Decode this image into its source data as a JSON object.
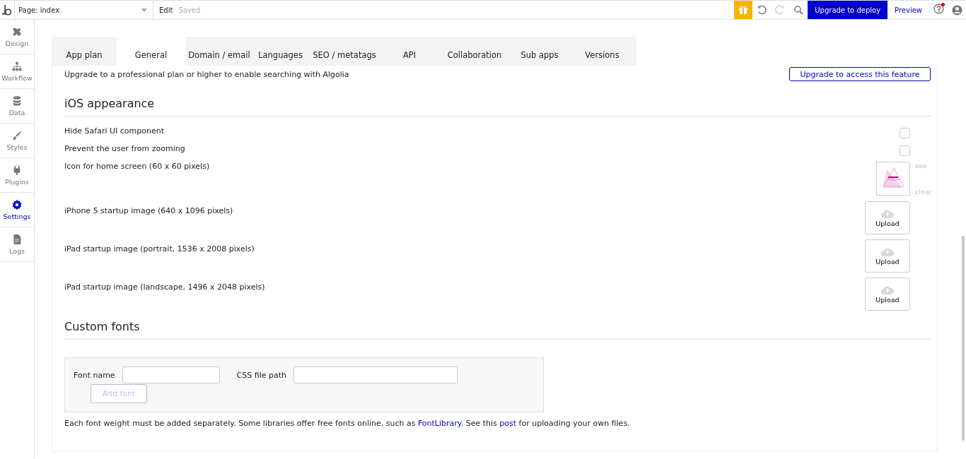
{
  "topbar": {
    "page_selector": "Page: index",
    "edit": "Edit",
    "save_status": "Saved",
    "upgrade_button": "Upgrade to deploy",
    "preview": "Preview",
    "help_notification": true
  },
  "sidebar": {
    "items": [
      {
        "label": "Design",
        "selected": false
      },
      {
        "label": "Workflow",
        "selected": false
      },
      {
        "label": "Data",
        "selected": false
      },
      {
        "label": "Styles",
        "selected": false
      },
      {
        "label": "Plugins",
        "selected": false
      },
      {
        "label": "Settings",
        "selected": true
      },
      {
        "label": "Logs",
        "selected": false
      }
    ]
  },
  "tabs": [
    {
      "label": "App plan",
      "selected": false
    },
    {
      "label": "General",
      "selected": true
    },
    {
      "label": "Domain / email",
      "selected": false
    },
    {
      "label": "Languages",
      "selected": false
    },
    {
      "label": "SEO / metatags",
      "selected": false
    },
    {
      "label": "API",
      "selected": false
    },
    {
      "label": "Collaboration",
      "selected": false
    },
    {
      "label": "Sub apps",
      "selected": false
    },
    {
      "label": "Versions",
      "selected": false
    }
  ],
  "algolia": {
    "text": "Upgrade to a professional plan or higher to enable searching with Algolia",
    "button": "Upgrade to access this feature"
  },
  "ios_appearance": {
    "title": "iOS appearance",
    "rows": [
      {
        "kind": "checkbox",
        "label": "Hide Safari UI component",
        "checked": false
      },
      {
        "kind": "checkbox",
        "label": "Prevent the user from zooming",
        "checked": false
      },
      {
        "kind": "image",
        "label": "Icon for home screen (60 x 60 pixels)",
        "see": "see",
        "clear": "clear"
      },
      {
        "kind": "upload",
        "label": "iPhone 5 startup image (640 x 1096 pixels)",
        "button": "Upload"
      },
      {
        "kind": "upload",
        "label": "iPad startup image (portrait, 1536 x 2008 pixels)",
        "button": "Upload"
      },
      {
        "kind": "upload",
        "label": "iPad startup image (landscape, 1496 x 2048 pixels)",
        "button": "Upload"
      }
    ]
  },
  "custom_fonts": {
    "title": "Custom fonts",
    "fields": [
      {
        "label": "Font name"
      },
      {
        "label": "CSS file path"
      }
    ],
    "add_button": {
      "label": "Add font",
      "disabled": true
    },
    "note": [
      {
        "kind": "text",
        "text": "Each font weight must be added separately. Some libraries offer free fonts online, such as "
      },
      {
        "kind": "link",
        "text": "FontLibrary"
      },
      {
        "kind": "text",
        "text": ". See this "
      },
      {
        "kind": "link",
        "text": "post"
      },
      {
        "kind": "text",
        "text": " for uploading your own files."
      }
    ]
  }
}
